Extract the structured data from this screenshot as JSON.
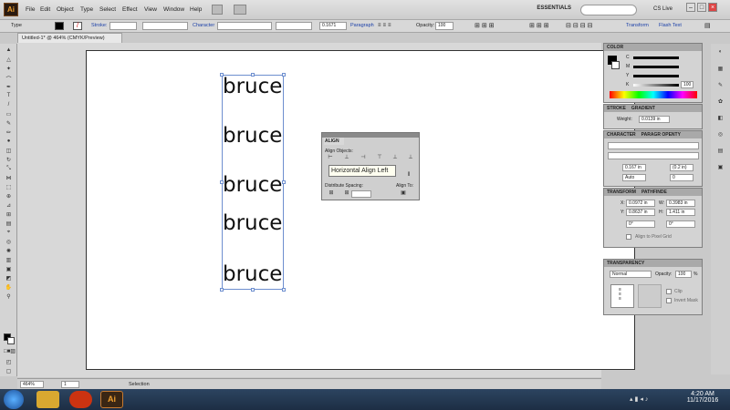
{
  "app": {
    "logo": "Ai"
  },
  "menu": {
    "items": [
      "File",
      "Edit",
      "Object",
      "Type",
      "Select",
      "Effect",
      "View",
      "Window",
      "Help"
    ]
  },
  "workspace": {
    "label": "ESSENTIALS"
  },
  "cslive": "CS Live",
  "controlbar": {
    "tool": "Type",
    "stroke": "Stroke:",
    "character": "Character",
    "paragraph": "Paragraph",
    "opacity_label": "Opacity:",
    "opacity": "100",
    "transform": "Transform",
    "flash": "Flash Text",
    "size": "0.1671"
  },
  "document": {
    "tab": "Untitled-1* @ 464% (CMYK/Preview)"
  },
  "canvas": {
    "words": [
      "bruce",
      "bruce",
      "bruce",
      "bruce",
      "bruce"
    ]
  },
  "align": {
    "title": "ALIGN",
    "align_objects": "Align Objects:",
    "distribute": "Distribute Spacing:",
    "align_to": "Align To:"
  },
  "tooltip": "Horizontal Align Left",
  "color": {
    "title": "COLOR",
    "c": "C",
    "m": "M",
    "y": "Y",
    "k": "K",
    "k_val": "100"
  },
  "stroke": {
    "title": "STROKE",
    "gradient": "GRADIENT",
    "weight_label": "Weight:",
    "weight": "0.0139 in"
  },
  "character": {
    "title": "CHARACTER",
    "para": "PARAGR OPENTY",
    "size": "0.167 in",
    "lead": "(0.2 in)",
    "kern": "Auto",
    "track": "0"
  },
  "transform": {
    "title": "TRANSFORM",
    "pathfinder": "PATHFINDE",
    "x_label": "X:",
    "x": "0.0972 in",
    "w_label": "W:",
    "w": "0.3983 in",
    "y_label": "Y:",
    "y": "0.8637 in",
    "h_label": "H:",
    "h": "1.411 in",
    "rot": "0°",
    "shear": "0°",
    "pixel": "Align to Pixel Grid"
  },
  "transparency": {
    "title": "TRANSPARENCY",
    "mode": "Normal",
    "opacity_label": "Opacity:",
    "opacity": "100",
    "pct": "%",
    "clip": "Clip",
    "invert": "Invert Mask"
  },
  "status": {
    "zoom": "464%",
    "page": "1",
    "tool": "Selection"
  },
  "taskbar": {
    "time": "4:20 AM",
    "date": "11/17/2016"
  }
}
